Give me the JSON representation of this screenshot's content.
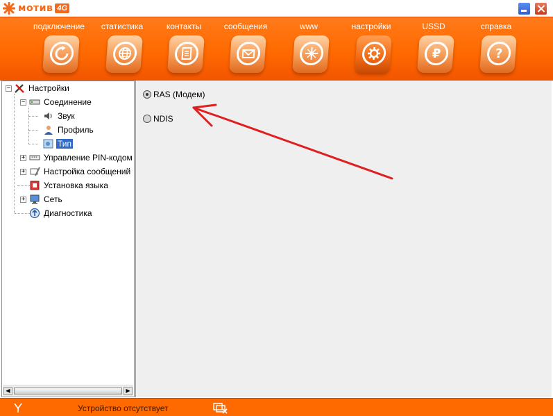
{
  "app": {
    "brand": "мотив",
    "brand_badge": "4G"
  },
  "window_controls": {
    "minimize_icon": "minimize-icon",
    "close_icon": "close-icon"
  },
  "nav": [
    {
      "label": "подключение",
      "icon": "refresh-icon",
      "active": false
    },
    {
      "label": "статистика",
      "icon": "globe-icon",
      "active": false
    },
    {
      "label": "контакты",
      "icon": "contacts-icon",
      "active": false
    },
    {
      "label": "сообщения",
      "icon": "envelope-icon",
      "active": false
    },
    {
      "label": "www",
      "icon": "compass-icon",
      "active": false
    },
    {
      "label": "настройки",
      "icon": "gear-icon",
      "active": true
    },
    {
      "label": "USSD",
      "icon": "ruble-icon",
      "active": false
    },
    {
      "label": "справка",
      "icon": "help-icon",
      "active": false
    }
  ],
  "tree": {
    "root": "Настройки",
    "connection": "Соединение",
    "sound": "Звук",
    "profile": "Профиль",
    "type": "Тип",
    "pin": "Управление PIN-кодом",
    "sms": "Настройка сообщений",
    "language": "Установка языка",
    "network": "Сеть",
    "diagnostics": "Диагностика"
  },
  "connection_type": {
    "options": [
      "RAS (Модем)",
      "NDIS"
    ],
    "selected": "RAS (Модем)"
  },
  "status": {
    "text": "Устройство отсутствует"
  },
  "colors": {
    "accent": "#ff6a00",
    "selection": "#316ac5",
    "annotation_arrow": "#e02020"
  }
}
